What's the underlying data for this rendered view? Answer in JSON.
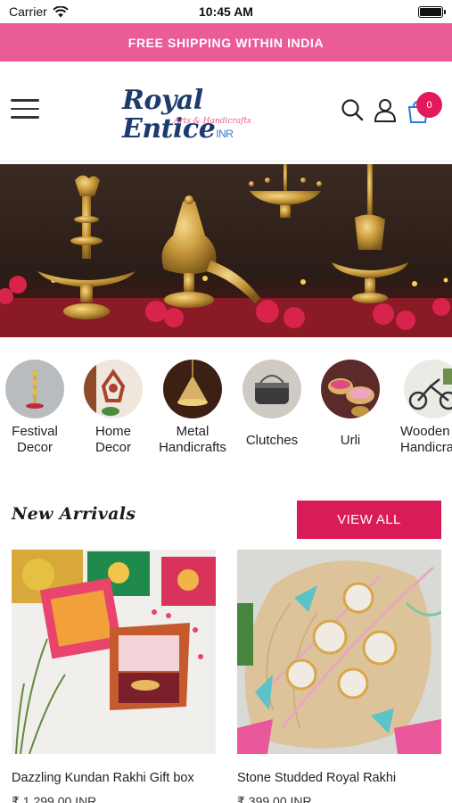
{
  "status_bar": {
    "carrier": "Carrier",
    "time": "10:45 AM"
  },
  "promo": {
    "text": "FREE SHIPPING WITHIN INDIA"
  },
  "header": {
    "logo_main": "Royal Entice",
    "logo_currency": "INR",
    "logo_tagline": "Arts & Handicrafts",
    "cart_count": "0"
  },
  "categories": [
    {
      "label": "Festival\nDecor"
    },
    {
      "label": "Home\nDecor"
    },
    {
      "label": "Metal\nHandicrafts"
    },
    {
      "label": "Clutches"
    },
    {
      "label": "Urli"
    },
    {
      "label": "Wooden\nHandicrafts"
    }
  ],
  "new_arrivals": {
    "title": "New Arrivals",
    "view_all": "VIEW ALL",
    "products": [
      {
        "name": "Dazzling Kundan Rakhi Gift box",
        "price": "₹ 1,299.00 INR"
      },
      {
        "name": "Stone Studded Royal Rakhi",
        "price": "₹ 399.00 INR"
      }
    ]
  },
  "colors": {
    "promo_bg": "#e95c95",
    "accent": "#d91c57",
    "logo_blue": "#1c3b6e"
  }
}
